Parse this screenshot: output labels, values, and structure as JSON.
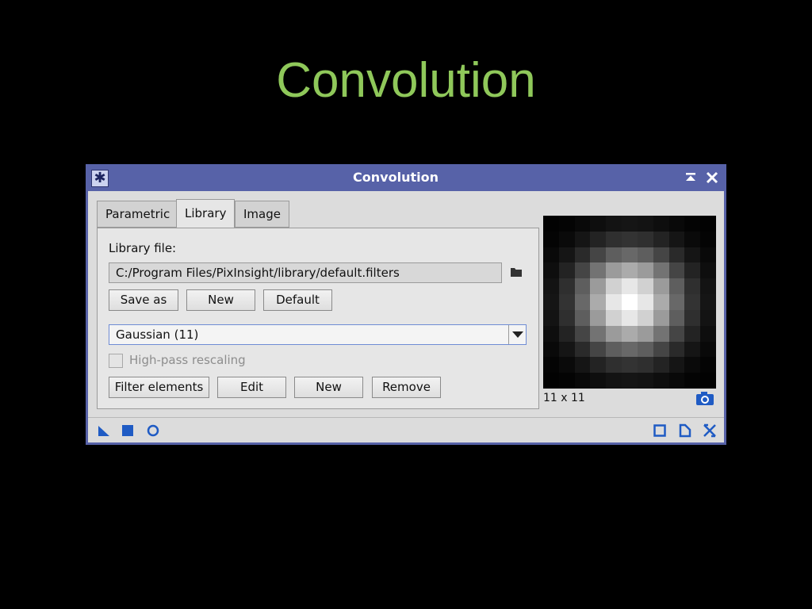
{
  "slide": {
    "title": "Convolution"
  },
  "window": {
    "title": "Convolution",
    "icons": {
      "app": "asterisk-icon",
      "shade": "shade-icon",
      "close": "close-icon"
    }
  },
  "tabs": [
    {
      "label": "Parametric",
      "active": false
    },
    {
      "label": "Library",
      "active": true
    },
    {
      "label": "Image",
      "active": false
    }
  ],
  "library": {
    "file_label": "Library file:",
    "file_path": "C:/Program Files/PixInsight/library/default.filters",
    "buttons": {
      "save_as": "Save as",
      "new": "New",
      "default": "Default"
    },
    "filter_select": "Gaussian (11)",
    "high_pass": {
      "label": "High-pass rescaling",
      "checked": false,
      "enabled": false
    },
    "action_buttons": {
      "filter_elements": "Filter elements",
      "edit": "Edit",
      "new": "New",
      "remove": "Remove"
    }
  },
  "preview": {
    "size_label": "11 x 11",
    "kernel_size": 11
  },
  "bottom_bar": {
    "left_icons": [
      "new-instance-icon",
      "apply-square-icon",
      "apply-global-icon"
    ],
    "right_icons": [
      "preview-icon",
      "documentation-icon",
      "reset-icon"
    ]
  },
  "colors": {
    "title_green": "#8fc85a",
    "window_frame": "#5762a8",
    "icon_blue": "#1f5bc4"
  }
}
